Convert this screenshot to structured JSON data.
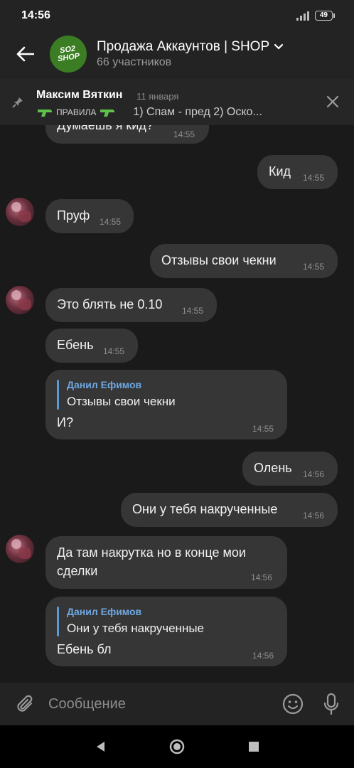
{
  "status": {
    "time": "14:56",
    "battery": "49"
  },
  "header": {
    "title": "Продажа Аккаунтов | SHOP",
    "subtitle": "66 участников",
    "avatar_text": "SO2 SHOP"
  },
  "pinned": {
    "author": "Максим Вяткин",
    "date": "11 января",
    "rules": "ПРАВИЛА",
    "text": "1) Спам - пред   2) Оско..."
  },
  "messages": {
    "m0": {
      "text": "Думаешь я кид?",
      "time": "14:55"
    },
    "m1": {
      "text": "Кид",
      "time": "14:55"
    },
    "m2": {
      "text": "Пруф",
      "time": "14:55"
    },
    "m3": {
      "text": "Отзывы свои чекни",
      "time": "14:55"
    },
    "m4": {
      "text": "Это блять не 0.10",
      "time": "14:55"
    },
    "m5": {
      "text": "Ебень",
      "time": "14:55"
    },
    "m6": {
      "reply_name": "Данил Ефимов",
      "reply_text": "Отзывы свои чекни",
      "text": "И?",
      "time": "14:55"
    },
    "m7": {
      "text": "Олень",
      "time": "14:56"
    },
    "m8": {
      "text": "Они у тебя накрученные",
      "time": "14:56"
    },
    "m9": {
      "text_line1": "Да там накрутка но в конце мои",
      "text_line2": "сделки",
      "time": "14:56"
    },
    "m10": {
      "reply_name": "Данил Ефимов",
      "reply_text": "Они у тебя накрученные",
      "text": "Ебень бл",
      "time": "14:56"
    }
  },
  "input": {
    "placeholder": "Сообщение"
  },
  "icons": [
    "back-arrow-icon",
    "chevron-down-icon",
    "pin-icon",
    "close-icon",
    "paperclip-icon",
    "emoji-icon",
    "microphone-icon",
    "nav-back-icon",
    "nav-home-icon",
    "nav-recents-icon"
  ],
  "colors": {
    "background": "#1a1a1a",
    "bubble": "#363636",
    "header": "#232323",
    "reply_accent": "#5b9bd5",
    "avatar_green": "#3a7d23"
  }
}
